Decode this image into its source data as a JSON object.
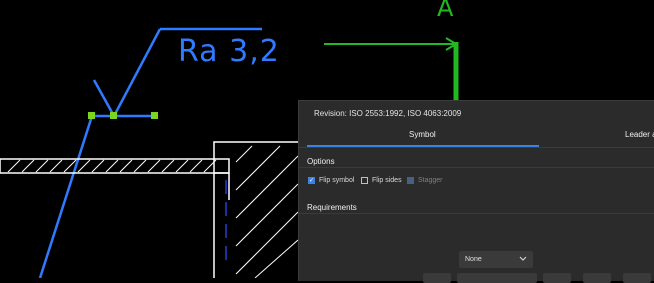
{
  "drawing": {
    "roughness_label": "Ra 3,2",
    "section_label": "A"
  },
  "dialog": {
    "revision": "Revision: ISO 2553:1992, ISO 4063:2009",
    "tabs": [
      {
        "label": "Symbol",
        "active": true
      },
      {
        "label": "Leader a"
      }
    ],
    "options": {
      "header": "Options",
      "checkboxes": [
        {
          "label": "Flip symbol",
          "checked": true,
          "enabled": true
        },
        {
          "label": "Flip sides",
          "checked": false,
          "enabled": true
        },
        {
          "label": "Stagger",
          "checked": false,
          "enabled": false
        }
      ]
    },
    "requirements": {
      "header": "Requirements",
      "dropdown_value": "None"
    }
  },
  "colors": {
    "accent": "#3a83e6",
    "symbol_blue": "#2f7bff",
    "section_green": "#22b822",
    "grip_green": "#7ad61f",
    "panel_bg": "#2b2b2b"
  }
}
